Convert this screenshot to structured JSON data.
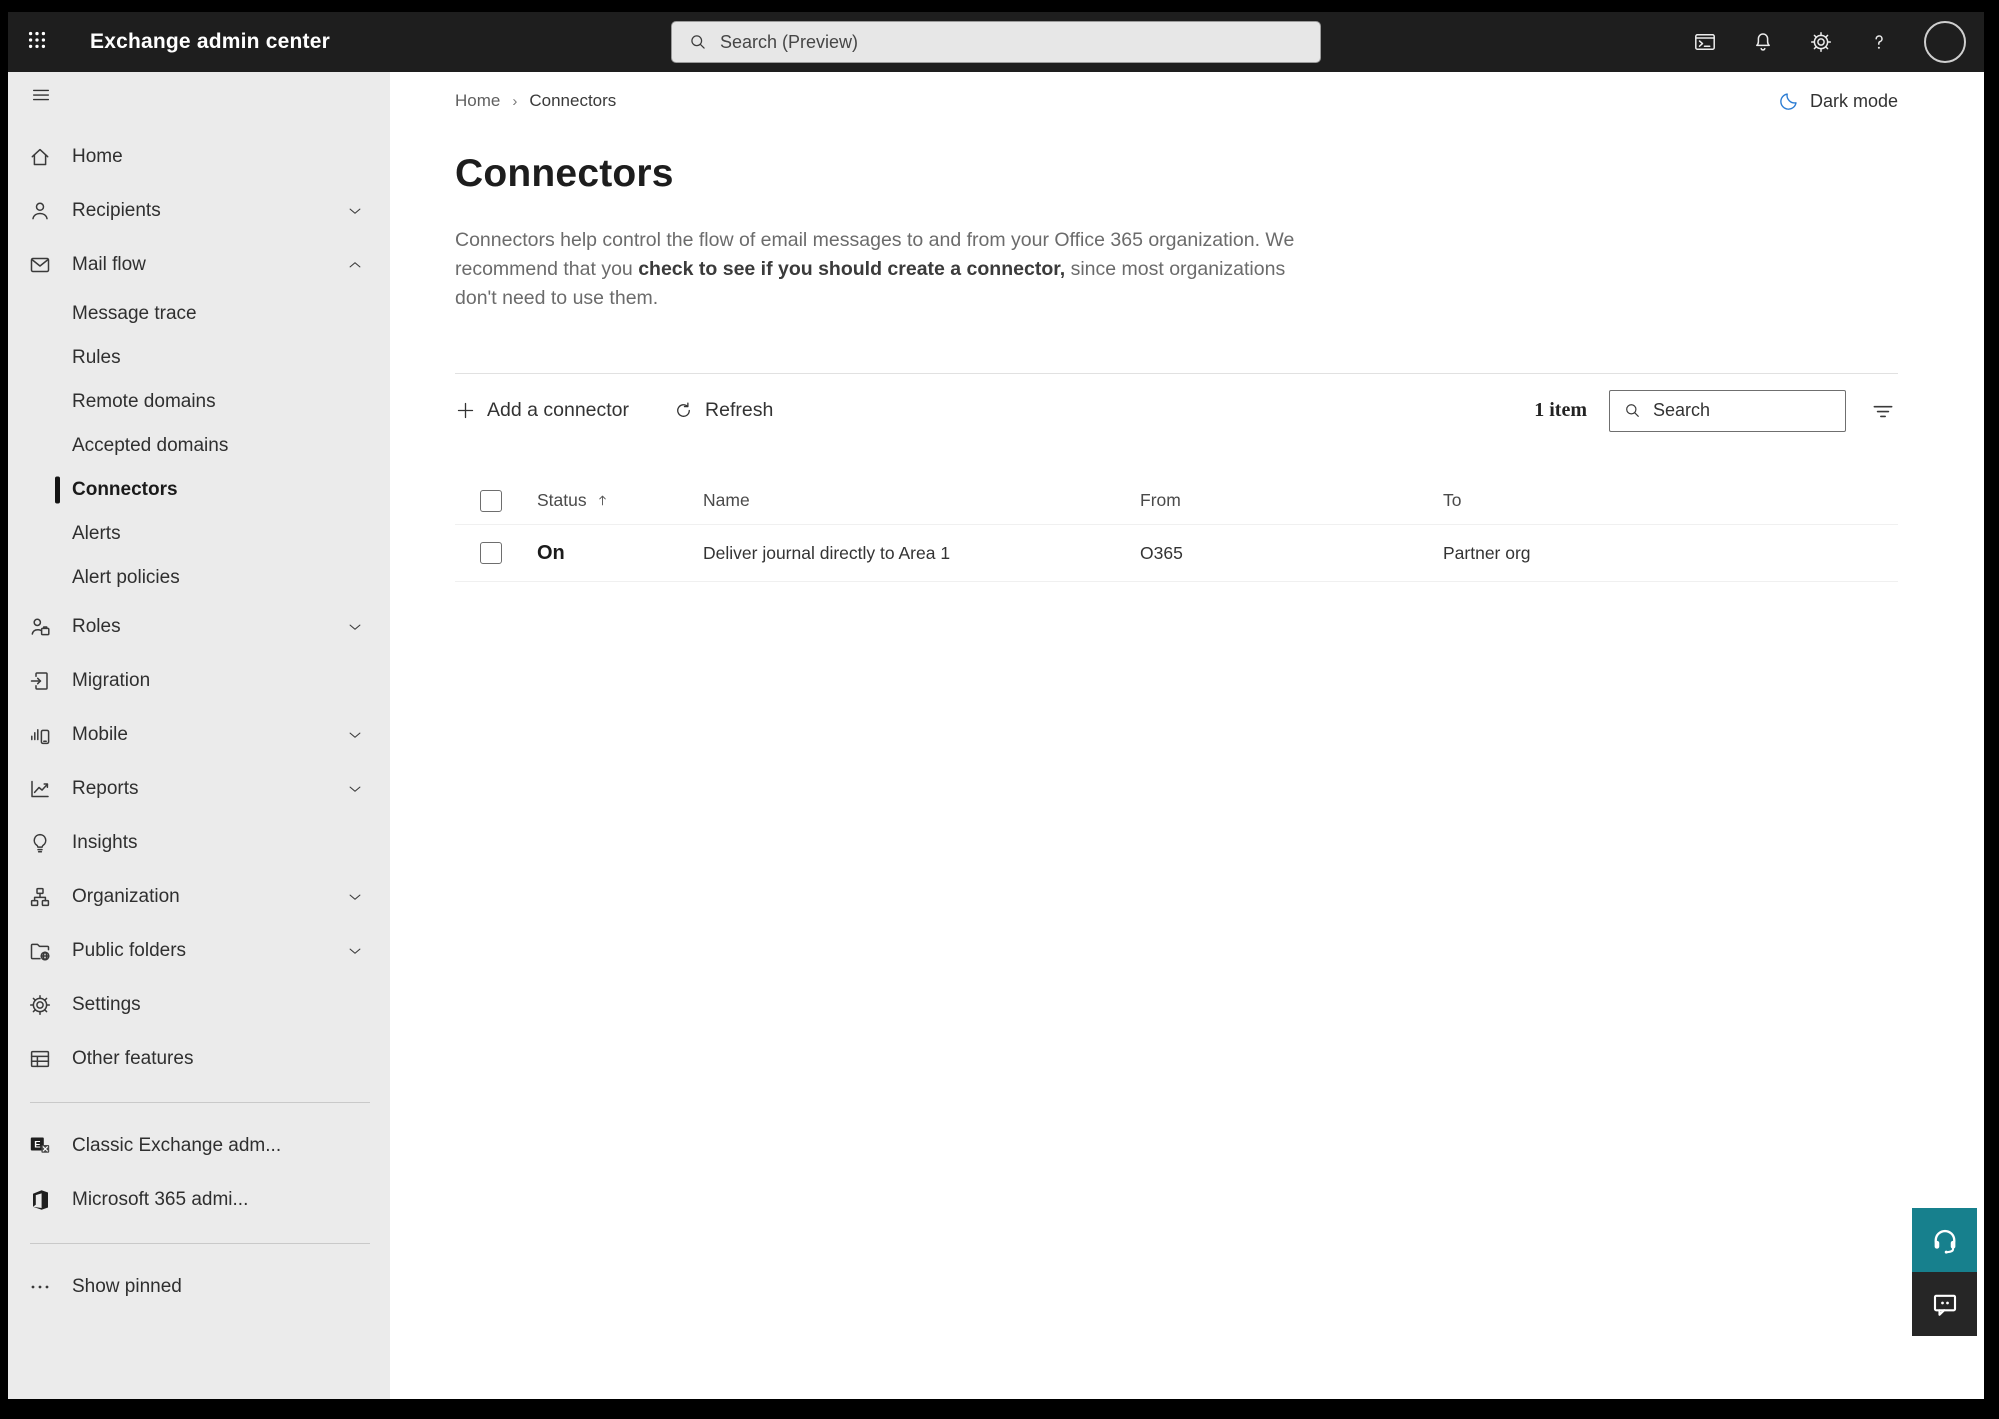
{
  "topbar": {
    "app_title": "Exchange admin center",
    "search_placeholder": "Search (Preview)",
    "icons": [
      "waffle-icon",
      "terminal-icon",
      "bell-icon",
      "gear-icon",
      "help-icon",
      "avatar"
    ]
  },
  "sidebar": {
    "items": [
      {
        "label": "Home",
        "icon": "home-icon"
      },
      {
        "label": "Recipients",
        "icon": "person-icon",
        "chevron": "down"
      },
      {
        "label": "Mail flow",
        "icon": "mail-icon",
        "chevron": "up"
      },
      {
        "label": "Message trace",
        "child": true
      },
      {
        "label": "Rules",
        "child": true
      },
      {
        "label": "Remote domains",
        "child": true
      },
      {
        "label": "Accepted domains",
        "child": true
      },
      {
        "label": "Connectors",
        "child": true,
        "selected": true
      },
      {
        "label": "Alerts",
        "child": true
      },
      {
        "label": "Alert policies",
        "child": true
      },
      {
        "label": "Roles",
        "icon": "roles-icon",
        "chevron": "down"
      },
      {
        "label": "Migration",
        "icon": "migration-icon"
      },
      {
        "label": "Mobile",
        "icon": "mobile-icon",
        "chevron": "down"
      },
      {
        "label": "Reports",
        "icon": "reports-icon",
        "chevron": "down"
      },
      {
        "label": "Insights",
        "icon": "insights-icon"
      },
      {
        "label": "Organization",
        "icon": "organization-icon",
        "chevron": "down"
      },
      {
        "label": "Public folders",
        "icon": "public-folders-icon",
        "chevron": "down"
      },
      {
        "label": "Settings",
        "icon": "settings-icon"
      },
      {
        "label": "Other features",
        "icon": "other-features-icon"
      },
      {
        "divider": true
      },
      {
        "label": "Classic Exchange adm...",
        "icon": "classic-exchange-icon"
      },
      {
        "label": "Microsoft 365 admi...",
        "icon": "microsoft-365-icon"
      },
      {
        "divider": true
      },
      {
        "label": "Show pinned",
        "icon": "ellipsis-icon"
      }
    ]
  },
  "breadcrumb": {
    "items": [
      "Home",
      "Connectors"
    ]
  },
  "dark_mode": {
    "label": "Dark mode",
    "icon": "moon-icon"
  },
  "page": {
    "title": "Connectors",
    "description_pre": "Connectors help control the flow of email messages to and from your Office 365 organization. We recommend that you ",
    "description_emphasis": "check to see if you should create a connector,",
    "description_post": " since most organizations don't need to use them."
  },
  "toolbar": {
    "add_label": "Add a connector",
    "refresh_label": "Refresh",
    "item_count": "1 item",
    "search_placeholder": "Search"
  },
  "table": {
    "columns": [
      "Status",
      "Name",
      "From",
      "To"
    ],
    "sort_column": "Status",
    "sort_direction": "asc",
    "rows": [
      {
        "status": "On",
        "name": "Deliver journal directly to Area 1",
        "from": "O365",
        "to": "Partner org"
      }
    ]
  },
  "colors": {
    "topbar_bg": "#1e1e1e",
    "sidebar_bg": "#ebebeb",
    "accent_teal": "#17808d",
    "moon_blue": "#2b7cd3",
    "selected_indicator": "#141414"
  }
}
